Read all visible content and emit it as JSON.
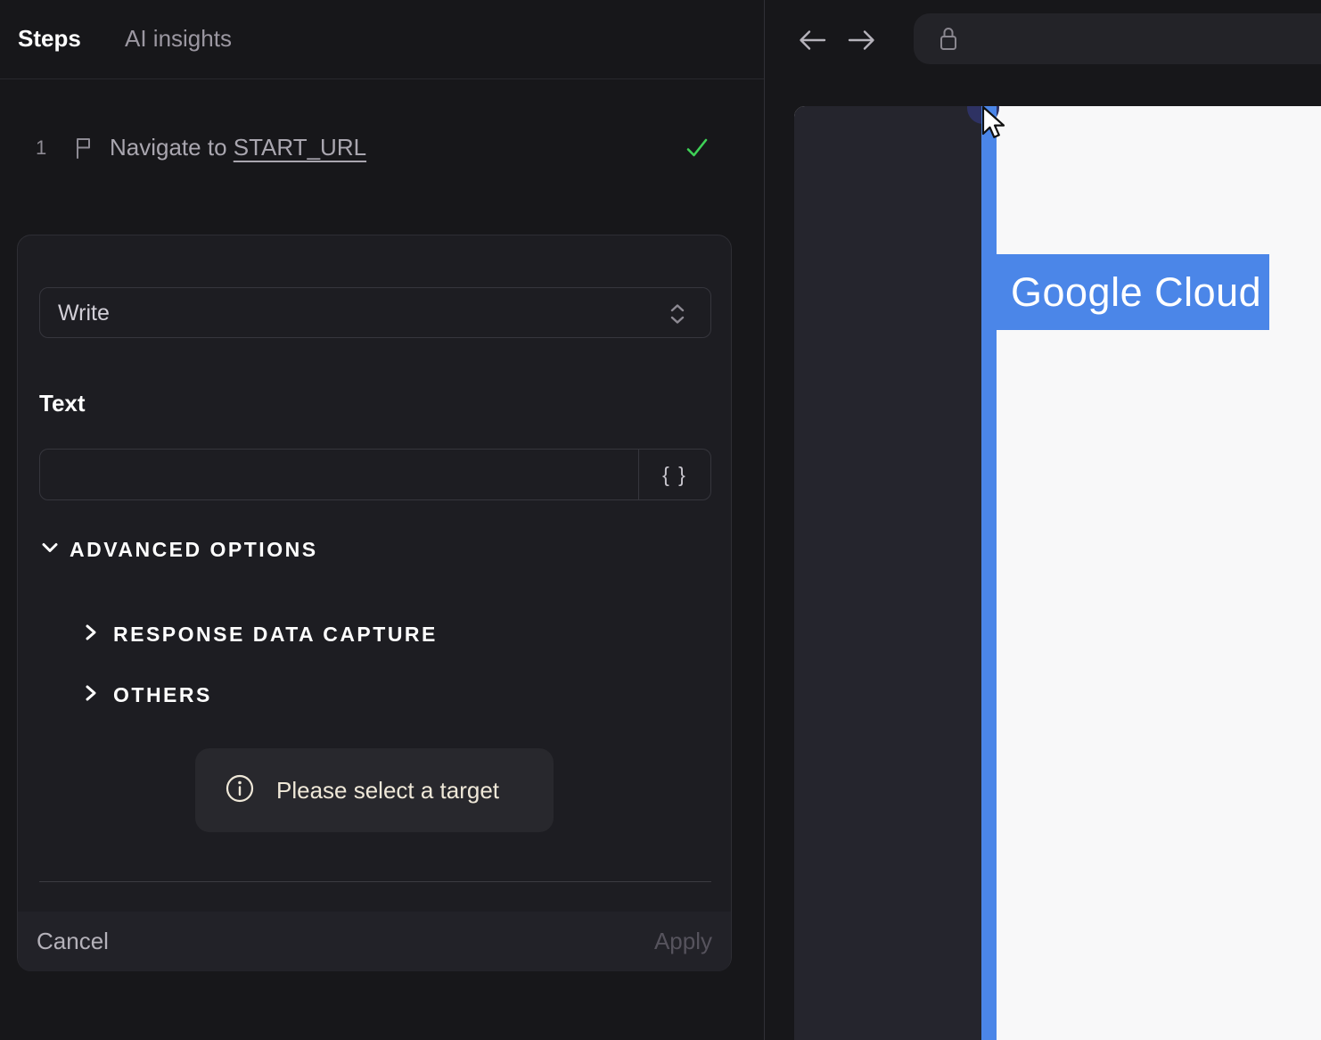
{
  "colors": {
    "accent_blue": "#4b86e8",
    "success_green": "#3ed156",
    "notice_text": "#efe8d8",
    "panel_background": "#17171a"
  },
  "left_panel": {
    "tabs": [
      {
        "label": "Steps"
      },
      {
        "label": "AI insights"
      }
    ],
    "step": {
      "number": "1",
      "action_text": "Navigate to",
      "target_text": "START_URL"
    },
    "editor": {
      "action_select": {
        "value": "Write"
      },
      "text_field": {
        "label": "Text",
        "value": "",
        "token_button_label": "{ }"
      },
      "sections": {
        "advanced_label": "ADVANCED OPTIONS",
        "response_label": "RESPONSE DATA CAPTURE",
        "others_label": "OTHERS"
      },
      "notice_text": "Please select a target",
      "footer": {
        "cancel_label": "Cancel",
        "apply_label": "Apply"
      }
    }
  },
  "browser": {
    "page": {
      "logo_text": "Google Cloud"
    }
  }
}
